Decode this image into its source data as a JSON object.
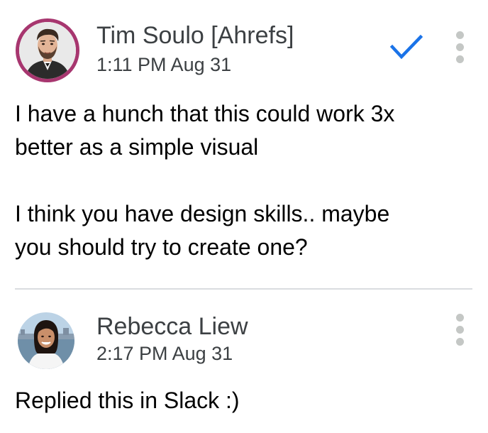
{
  "comments": [
    {
      "author": "Tim Soulo [Ahrefs]",
      "timestamp": "1:11 PM Aug 31",
      "body": "I have a hunch that this could work 3x\nbetter as a simple visual\n\nI think you have design skills.. maybe\nyou should try to create one?",
      "avatar_ring_color": "#a7366f",
      "resolve_icon": "checkmark-icon",
      "resolve_color": "#1a73e8",
      "menu_icon": "more-vert-icon"
    },
    {
      "author": "Rebecca Liew",
      "timestamp": "2:17 PM Aug 31",
      "body": "Replied this in Slack :)",
      "menu_icon": "more-vert-icon"
    }
  ]
}
